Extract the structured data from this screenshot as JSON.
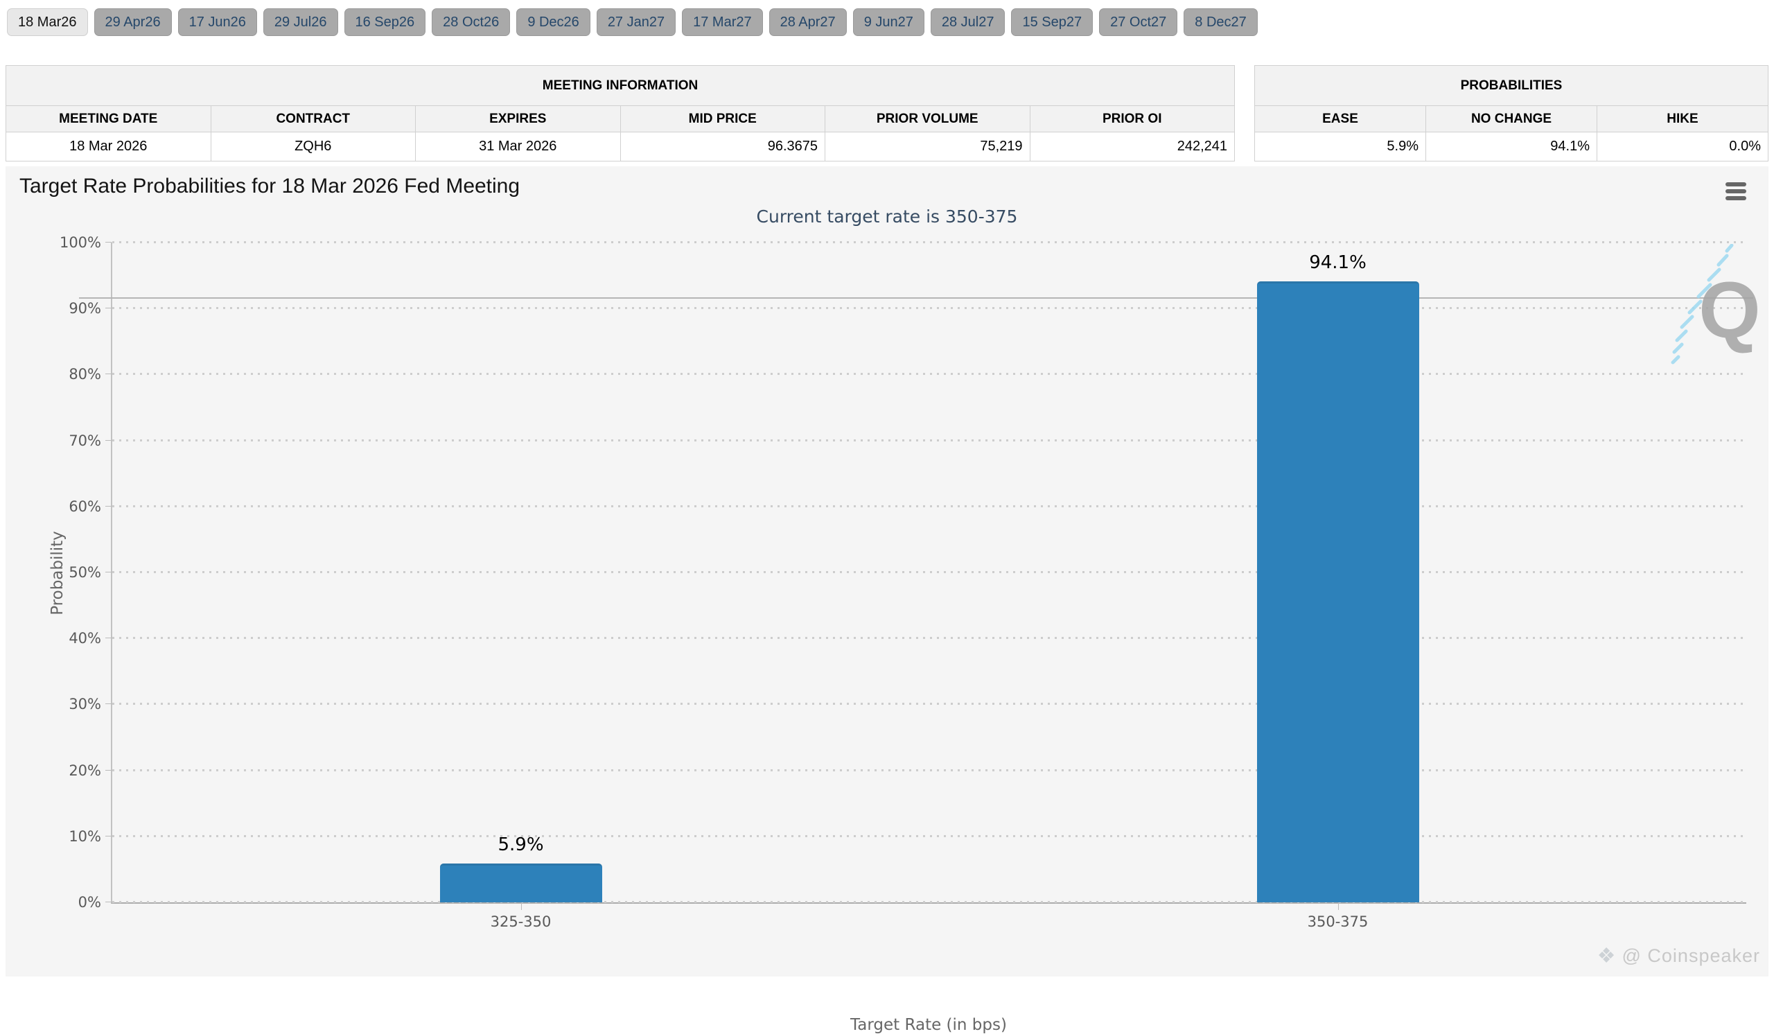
{
  "tabs": {
    "selected": "18 Mar26",
    "items": [
      "18 Mar26",
      "29 Apr26",
      "17 Jun26",
      "29 Jul26",
      "16 Sep26",
      "28 Oct26",
      "9 Dec26",
      "27 Jan27",
      "17 Mar27",
      "28 Apr27",
      "9 Jun27",
      "28 Jul27",
      "15 Sep27",
      "27 Oct27",
      "8 Dec27"
    ]
  },
  "meeting_information": {
    "title": "MEETING INFORMATION",
    "columns": [
      {
        "label": "MEETING DATE",
        "value": "18 Mar 2026"
      },
      {
        "label": "CONTRACT",
        "value": "ZQH6"
      },
      {
        "label": "EXPIRES",
        "value": "31 Mar 2026"
      },
      {
        "label": "MID PRICE",
        "value": "96.3675"
      },
      {
        "label": "PRIOR VOLUME",
        "value": "75,219"
      },
      {
        "label": "PRIOR OI",
        "value": "242,241"
      }
    ]
  },
  "probabilities": {
    "title": "PROBABILITIES",
    "columns": [
      {
        "label": "EASE",
        "value": "5.9%"
      },
      {
        "label": "NO CHANGE",
        "value": "94.1%"
      },
      {
        "label": "HIKE",
        "value": "0.0%"
      }
    ]
  },
  "chart_toolbar": {
    "menu_icon": "hamburger-icon"
  },
  "chart_data": {
    "type": "bar",
    "title": "Target Rate Probabilities for 18 Mar 2026 Fed Meeting",
    "subtitle": "Current target rate is 350-375",
    "categories": [
      "325-350",
      "350-375"
    ],
    "values": [
      5.9,
      94.1
    ],
    "data_labels": [
      "5.9%",
      "94.1%"
    ],
    "xlabel": "Target Rate (in bps)",
    "ylabel": "Probability",
    "ylim": [
      0,
      100
    ],
    "ytick_step": 10,
    "ytick_suffix": "%",
    "grid": "horizontal-dotted",
    "legend": "none",
    "reference_line": {
      "y": 91.5,
      "style": "solid"
    },
    "bar_color": "#2d81ba"
  },
  "watermarks": {
    "q_logo": "Q",
    "attribution": "@ Coinspeaker",
    "attribution_icon": "diamond-icon"
  },
  "colors": {
    "bar": "#2d81ba",
    "chart_bg": "#f5f5f5",
    "tab_active_bg": "#e8e8e8",
    "tab_inactive_bg": "#a9a9a9",
    "tab_text": "#25476a",
    "subtitle_text": "#374c63",
    "axis_text": "#595959",
    "grid_line": "#cdcdcd",
    "reference_line": "#b5b5b5",
    "watermark_text": "#c8c8c8"
  }
}
